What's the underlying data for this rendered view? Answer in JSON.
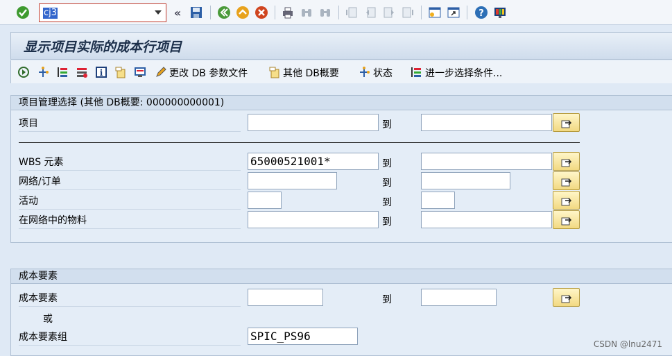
{
  "system_toolbar": {
    "command_field_value": "cj3",
    "icons": [
      "enter-icon",
      "save-icon",
      "back-icon",
      "exit-icon",
      "cancel-icon",
      "print-icon",
      "find-icon",
      "find-next-icon",
      "first-page-icon",
      "prev-page-icon",
      "next-page-icon",
      "last-page-icon",
      "new-session-icon",
      "shortcut-icon",
      "help-icon",
      "layout-icon"
    ]
  },
  "title": "显示项目实际的成本行项目",
  "app_toolbar": {
    "change_db_profile": "更改 DB 参数文件",
    "other_db_overview": "其他 DB概要",
    "status": "状态",
    "further_selection": "进一步选择条件..."
  },
  "project_group": {
    "header": "项目管理选择 (其他 DB概要: 000000000001)",
    "rows": [
      {
        "label": "项目",
        "from": "",
        "to_label": "到",
        "to": ""
      },
      {
        "label": "WBS 元素",
        "from": "65000521001*",
        "to_label": "到",
        "to": ""
      },
      {
        "label": "网络/订单",
        "from": "",
        "to_label": "到",
        "to": ""
      },
      {
        "label": "活动",
        "from": "",
        "to_label": "到",
        "to": ""
      },
      {
        "label": "在网络中的物料",
        "from": "",
        "to_label": "到",
        "to": ""
      }
    ]
  },
  "cost_element_group": {
    "header": "成本要素",
    "cost_element_label": "成本要素",
    "cost_element_from": "",
    "to_label": "到",
    "cost_element_to": "",
    "or_label": "或",
    "cost_element_group_label": "成本要素组",
    "cost_element_group_value": "SPIC_PS96"
  },
  "watermark": "CSDN @lnu2471",
  "colors": {
    "accent_red": "#c0392b",
    "selection_blue": "#3366cc",
    "background": "#dfe9f5"
  }
}
